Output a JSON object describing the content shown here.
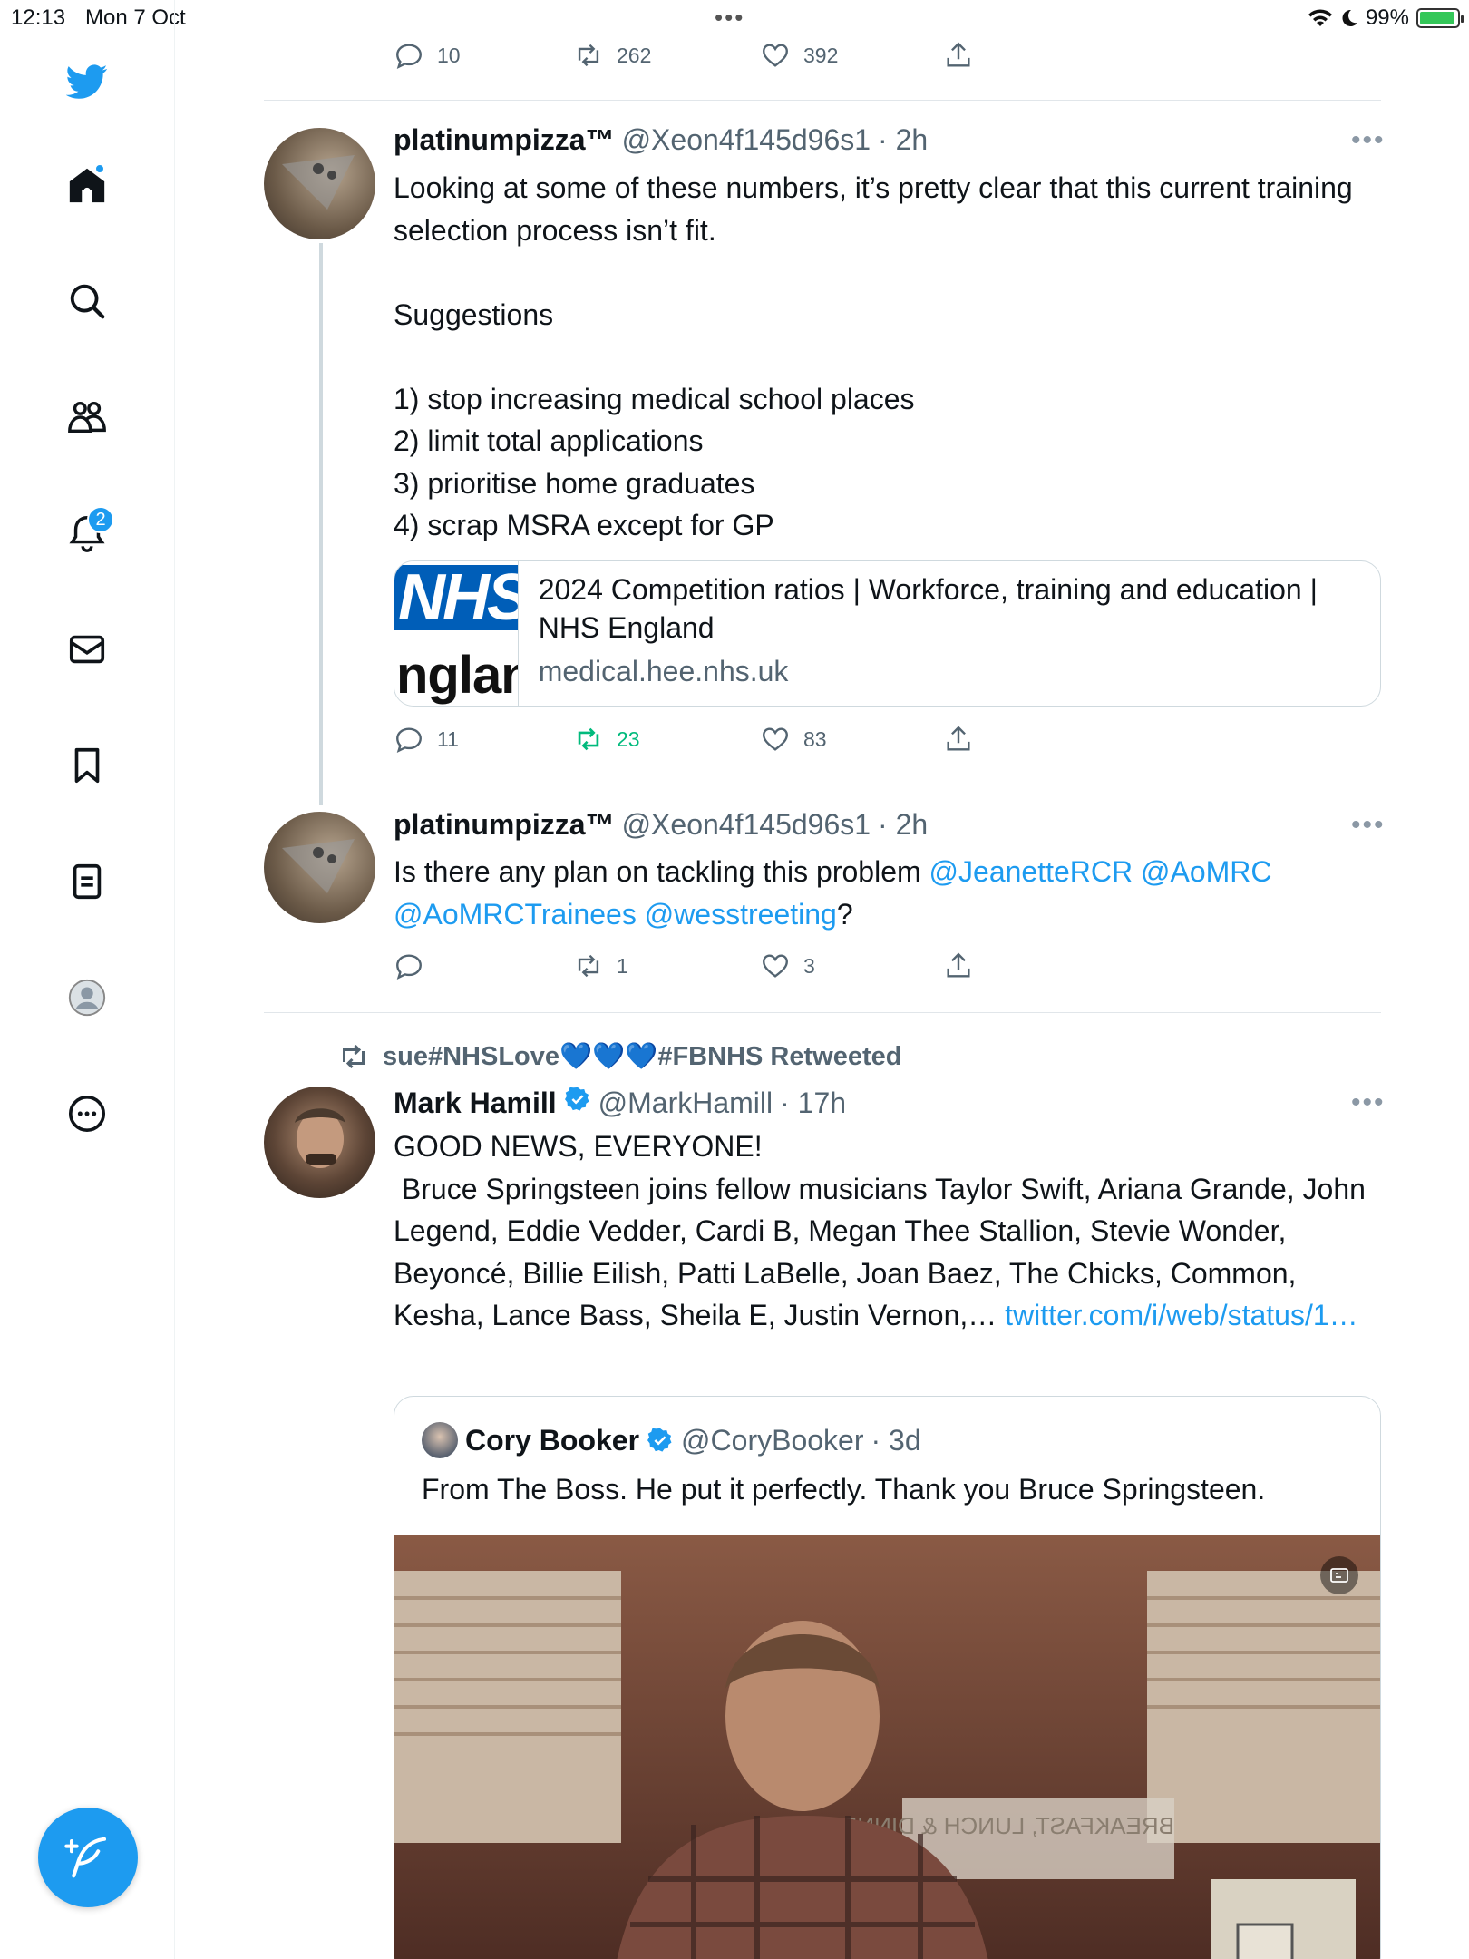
{
  "status_bar": {
    "time": "12:13",
    "date": "Mon 7 Oct",
    "battery": "99%"
  },
  "sidebar": {
    "notifications_badge": "2"
  },
  "top_tweet_actions": {
    "replies": "10",
    "retweets": "262",
    "likes": "392"
  },
  "tweet1": {
    "name": "platinumpizza™",
    "handle": "@Xeon4f145d96s1",
    "time": "· 2h",
    "text": "Looking at some of these numbers, it’s pretty clear that this current training selection process isn’t fit.\n\nSuggestions\n\n1) stop increasing medical school places\n2) limit total applications\n3) prioritise home graduates\n4) scrap MSRA except for GP",
    "card": {
      "thumb_top": "NHS",
      "thumb_bottom": "nglan",
      "title": "2024 Competition ratios | Workforce, training and education | NHS England",
      "domain": "medical.hee.nhs.uk"
    },
    "actions": {
      "replies": "11",
      "retweets": "23",
      "likes": "83"
    }
  },
  "tweet2": {
    "name": "platinumpizza™",
    "handle": "@Xeon4f145d96s1",
    "time": "· 2h",
    "text_before": "Is there any plan on tackling this problem ",
    "mention1": "@JeanetteRCR",
    "mention2": "@AoMRC",
    "mention3": "@AoMRCTrainees",
    "mention4": "@wesstreeting",
    "text_after": "?",
    "actions": {
      "replies": "",
      "retweets": "1",
      "likes": "3"
    }
  },
  "tweet3": {
    "retweeted_by": "sue#NHSLove💙💙💙#FBNHS Retweeted",
    "name": "Mark Hamill",
    "handle": "@MarkHamill",
    "time": "· 17h",
    "text": "GOOD NEWS, EVERYONE!\n Bruce Springsteen joins fellow musicians Taylor Swift, Ariana Grande, John Legend, Eddie Vedder, Cardi B, Megan Thee Stallion, Stevie Wonder, Beyoncé, Billie Eilish, Patti LaBelle, Joan Baez, The Chicks, Common, Kesha, Lance Bass, Sheila E, Justin Vernon,… ",
    "link": "twitter.com/i/web/status/1…",
    "quote": {
      "name": "Cory Booker",
      "handle": "@CoryBooker",
      "time": "· 3d",
      "text": "From The Boss. He put it perfectly. Thank you Bruce Springsteen.",
      "sign_text": "BREAKFAST, LUNCH & DINNER"
    }
  },
  "colors": {
    "accent": "#1d9bf0",
    "retweet_green": "#00ba7c",
    "muted": "#536471"
  }
}
